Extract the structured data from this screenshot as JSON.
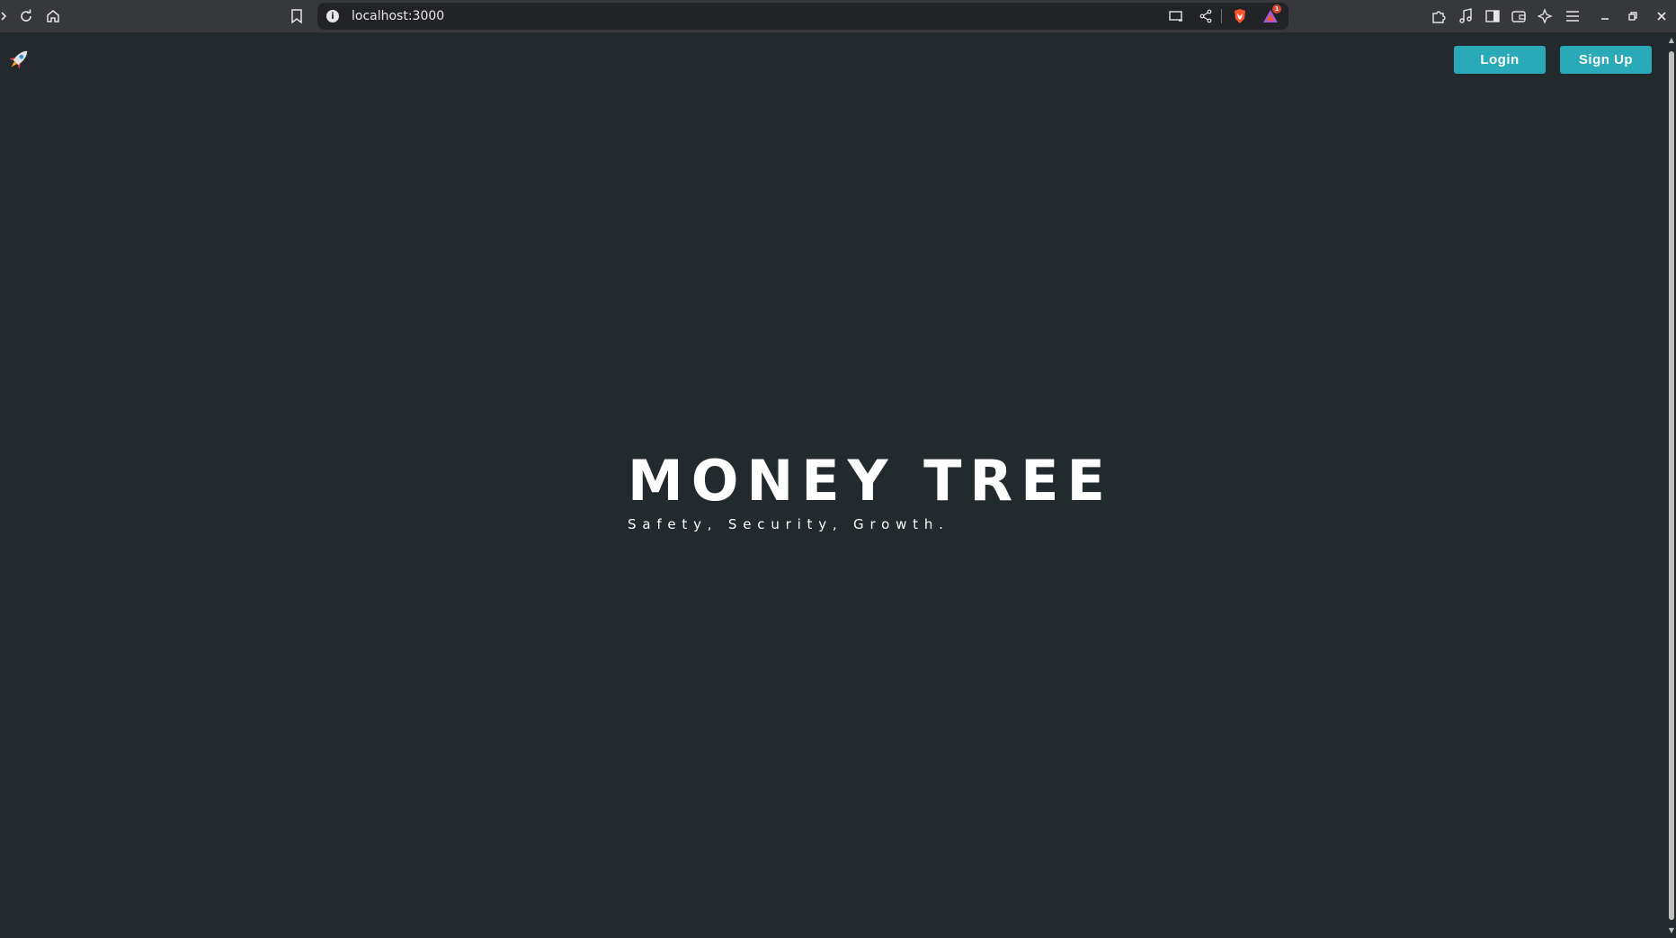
{
  "browser": {
    "url": "localhost:3000",
    "notification_count": "1",
    "icons": {
      "back": "chevron-left-icon",
      "reload": "reload-icon",
      "home": "home-icon",
      "bookmark": "bookmark-icon",
      "site_info": "info-icon",
      "cast": "cast-icon",
      "share": "share-icon",
      "brave_shields": "lion-shield-icon",
      "rewards": "triangle-rewards-icon",
      "extensions": "puzzle-icon",
      "media": "music-note-icon",
      "sidebar": "sidebar-icon",
      "wallet": "wallet-icon",
      "leo": "sparkle-icon",
      "menu": "hamburger-menu-icon",
      "minimize": "minimize-icon",
      "restore": "restore-icon",
      "close": "close-icon"
    }
  },
  "header": {
    "logo_icon": "rocket-icon",
    "login_label": "Login",
    "signup_label": "Sign Up"
  },
  "hero": {
    "title": "MONEY TREE",
    "subtitle": "Safety, Security, Growth."
  },
  "colors": {
    "page_background": "#232a2d",
    "button_accent": "#2aaab8",
    "chrome_background": "#37383c",
    "text": "#ffffff"
  }
}
